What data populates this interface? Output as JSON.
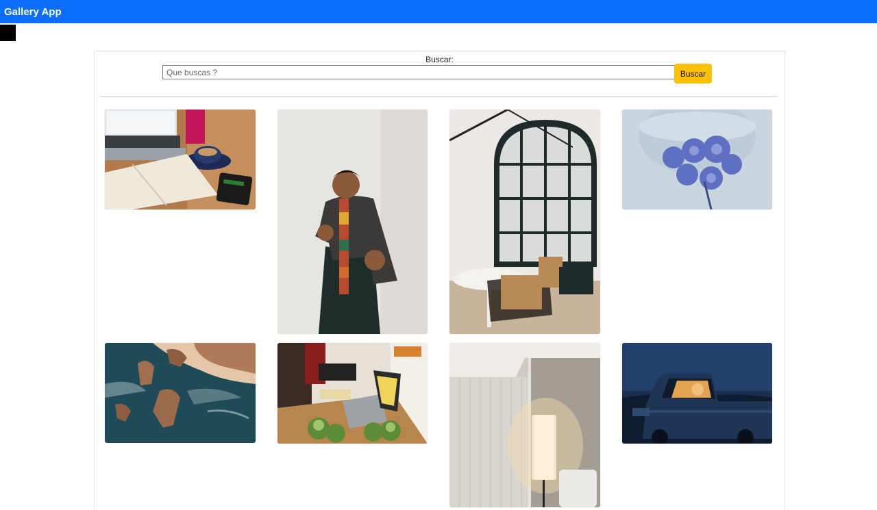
{
  "navbar": {
    "brand": "Gallery App"
  },
  "search": {
    "label": "Buscar:",
    "placeholder": "Que buscas ?",
    "value": "",
    "button_label": "Buscar"
  },
  "colors": {
    "navbar": "#0d6efd",
    "button": "#ffc107"
  },
  "gallery": {
    "photos": [
      {
        "subject": "laptop-coffee-notebook-photo"
      },
      {
        "subject": "man-dancing-scarf-photo"
      },
      {
        "subject": "arched-window-cafe-photo"
      },
      {
        "subject": "blue-flowers-photo"
      },
      {
        "subject": "rocky-coast-aerial-photo"
      },
      {
        "subject": "kitchen-laptop-vegetables-photo"
      },
      {
        "subject": "floor-lamp-interior-photo"
      },
      {
        "subject": "truck-at-night-photo"
      }
    ]
  }
}
